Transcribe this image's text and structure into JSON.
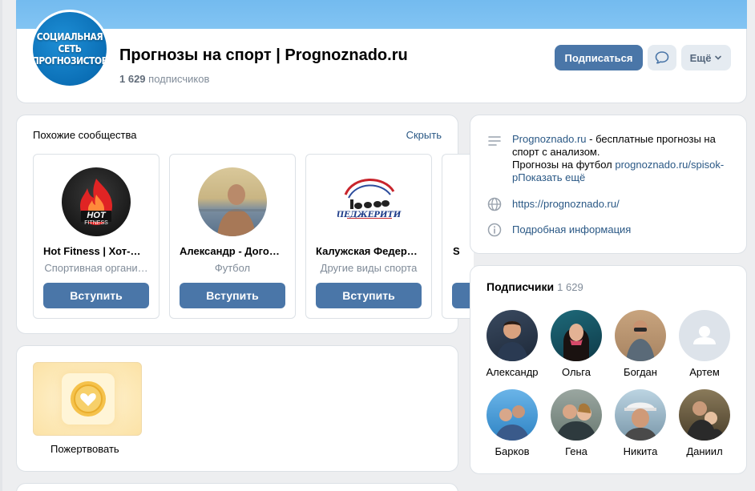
{
  "header": {
    "avatar_lines": [
      "СОЦИАЛЬНАЯ",
      "СЕТЬ",
      "ПРОГНОЗИСТОВ"
    ],
    "title": "Прогнозы на спорт | Prognoznado.ru",
    "subs_count": "1 629",
    "subs_label": "подписчиков",
    "subscribe_label": "Подписаться",
    "more_label": "Ещё",
    "accent": "#4a76a8"
  },
  "similar": {
    "title": "Похожие сообщества",
    "hide_label": "Скрыть",
    "items": [
      {
        "name": "Hot Fitness | Хот-Фи…",
        "category": "Спортивная органи…",
        "join": "Вступить",
        "logo_text": "HOT",
        "logo_sub": "FITNESS"
      },
      {
        "name": "Александр - Догов…",
        "category": "Футбол",
        "join": "Вступить"
      },
      {
        "name": "Калужская Федера…",
        "category": "Другие виды спорта",
        "join": "Вступить",
        "logo_text": "ПЕДЖЕРИТИ"
      },
      {
        "name": "S",
        "category": "",
        "join": ""
      }
    ]
  },
  "donate": {
    "label": "Пожертвовать"
  },
  "info": {
    "desc_link": "Prognoznado.ru",
    "desc_text1": " - бесплатные прогнозы на спорт с анализом.",
    "desc_text2": "Прогнозы на футбол ",
    "desc_link2": "prognoznado.ru/spisok-p",
    "desc_more": "Показать ещё",
    "site": "https://prognoznado.ru/",
    "details": "Подробная информация"
  },
  "subscribers": {
    "title": "Подписчики",
    "count": "1 629",
    "people": [
      {
        "name": "Александр"
      },
      {
        "name": "Ольга"
      },
      {
        "name": "Богдан"
      },
      {
        "name": "Артем"
      },
      {
        "name": "Барков"
      },
      {
        "name": "Гена"
      },
      {
        "name": "Никита"
      },
      {
        "name": "Даниил"
      }
    ]
  }
}
